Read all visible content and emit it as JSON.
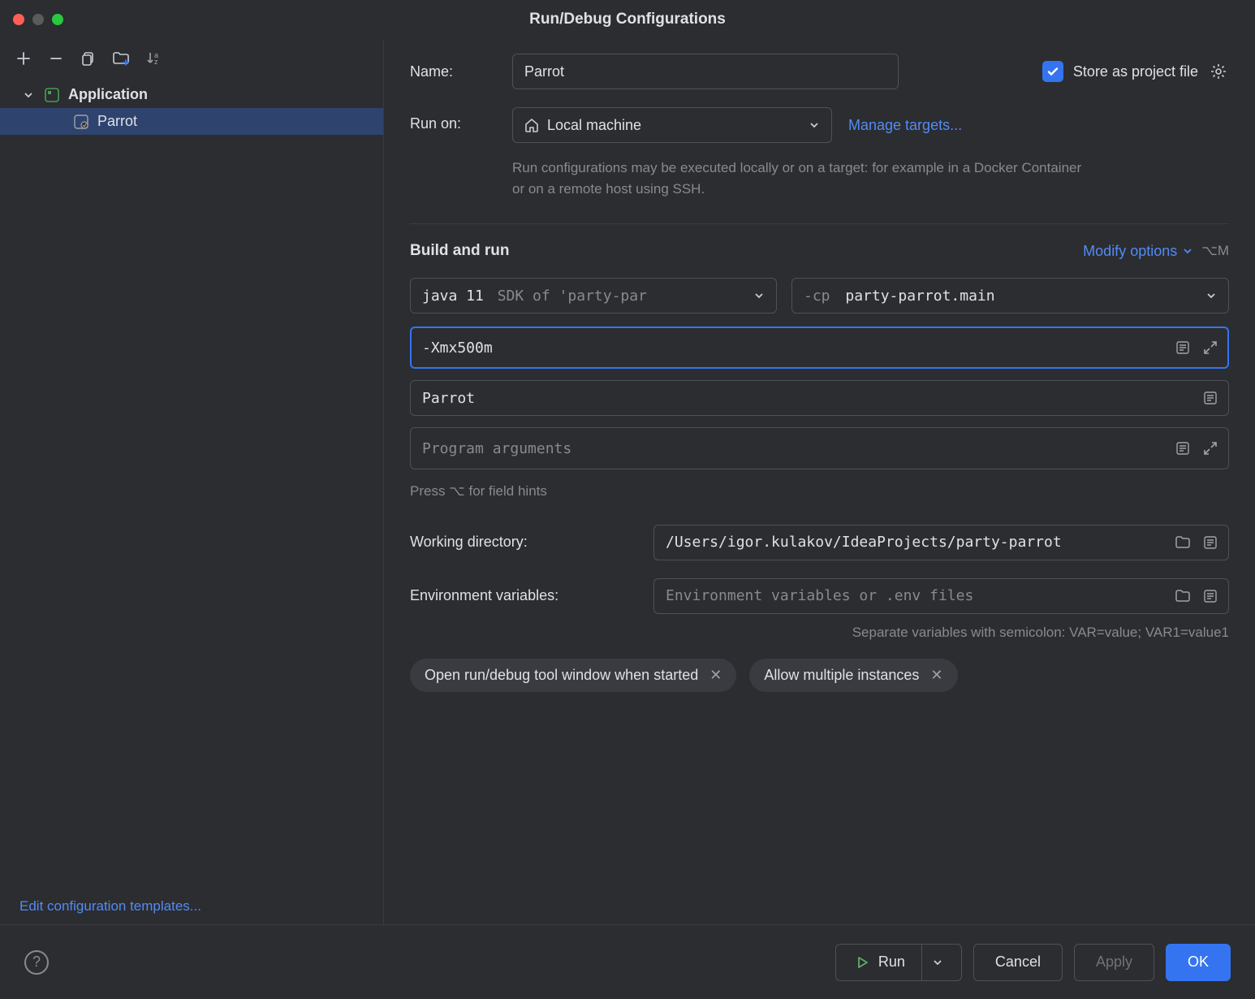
{
  "window": {
    "title": "Run/Debug Configurations"
  },
  "sidebar": {
    "group": {
      "label": "Application"
    },
    "items": [
      {
        "label": "Parrot"
      }
    ],
    "footer_link": "Edit configuration templates..."
  },
  "form": {
    "name_label": "Name:",
    "name_value": "Parrot",
    "store_label": "Store as project file",
    "run_on_label": "Run on:",
    "run_on_value": "Local machine",
    "manage_targets": "Manage targets...",
    "run_on_hint": "Run configurations may be executed locally or on a target: for example in a Docker Container or on a remote host using SSH.",
    "build_section": "Build and run",
    "modify_options": "Modify options",
    "modify_shortcut": "⌥M",
    "jdk_prefix": "java 11",
    "jdk_hint": "SDK of 'party-par",
    "cp_prefix": "-cp",
    "cp_value": "party-parrot.main",
    "vm_options": "-Xmx500m",
    "main_class": "Parrot",
    "program_args_placeholder": "Program arguments",
    "field_hints": "Press ⌥ for field hints",
    "workdir_label": "Working directory:",
    "workdir_value": "/Users/igor.kulakov/IdeaProjects/party-parrot",
    "env_label": "Environment variables:",
    "env_placeholder": "Environment variables or .env files",
    "env_hint": "Separate variables with semicolon: VAR=value; VAR1=value1",
    "chips": [
      {
        "label": "Open run/debug tool window when started"
      },
      {
        "label": "Allow multiple instances"
      }
    ]
  },
  "footer": {
    "run": "Run",
    "cancel": "Cancel",
    "apply": "Apply",
    "ok": "OK"
  }
}
